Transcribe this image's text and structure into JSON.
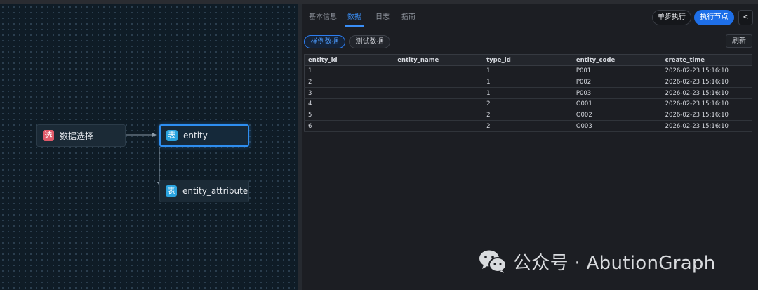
{
  "canvas": {
    "nodes": [
      {
        "label": "数据选择",
        "icon_text": "选",
        "icon": "select-icon",
        "color": "#e05a6a"
      },
      {
        "label": "entity",
        "icon_text": "表",
        "icon": "table-icon",
        "color": "#2aa4e0",
        "active": true
      },
      {
        "label": "entity_attribute",
        "icon_text": "表",
        "icon": "table-icon",
        "color": "#2aa4e0"
      }
    ]
  },
  "panel": {
    "tabs": [
      "基本信息",
      "数据",
      "日志",
      "指南"
    ],
    "active_tab": "数据",
    "step_button": "单步执行",
    "run_button": "执行节点",
    "collapse_button": "<",
    "subtabs": [
      "样例数据",
      "测试数据"
    ],
    "active_subtab": "样例数据",
    "refresh_button": "刷新",
    "table": {
      "columns": [
        "entity_id",
        "entity_name",
        "type_id",
        "entity_code",
        "create_time"
      ],
      "rows": [
        [
          "1",
          "",
          "1",
          "P001",
          "2026-02-23 15:16:10"
        ],
        [
          "2",
          "",
          "1",
          "P002",
          "2026-02-23 15:16:10"
        ],
        [
          "3",
          "",
          "1",
          "P003",
          "2026-02-23 15:16:10"
        ],
        [
          "4",
          "",
          "2",
          "O001",
          "2026-02-23 15:16:10"
        ],
        [
          "5",
          "",
          "2",
          "O002",
          "2026-02-23 15:16:10"
        ],
        [
          "6",
          "",
          "2",
          "O003",
          "2026-02-23 15:16:10"
        ]
      ]
    }
  },
  "watermark": {
    "text": "公众号 · AbutionGraph",
    "icon": "wechat-icon"
  }
}
